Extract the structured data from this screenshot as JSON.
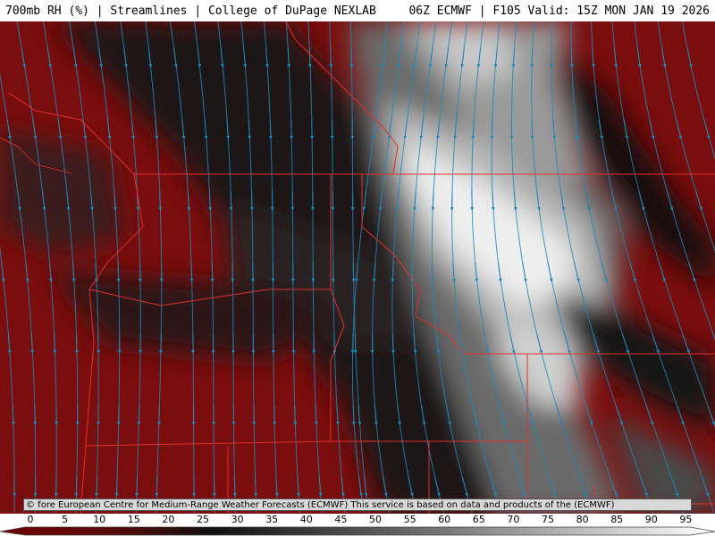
{
  "header": {
    "left": "700mb RH (%) | Streamlines | College of DuPage NEXLAB",
    "right": "06Z ECMWF | F105 Valid: 15Z MON JAN 19 2026"
  },
  "credit": "© fore European Centre for Medium-Range Weather Forecasts (ECMWF)  This service is based on data and products of the (ECMWF)",
  "colorbar": {
    "ticks": [
      "0",
      "5",
      "10",
      "15",
      "20",
      "25",
      "30",
      "35",
      "40",
      "45",
      "50",
      "55",
      "60",
      "65",
      "70",
      "75",
      "80",
      "85",
      "90",
      "95"
    ]
  },
  "colors": {
    "dry": "#7a0d0d",
    "moist": "#f2f2f2",
    "streamline": "#1e88b8",
    "border": "#e03030"
  }
}
